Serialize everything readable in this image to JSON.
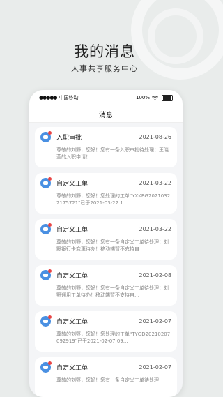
{
  "hero": {
    "title": "我的消息",
    "subtitle": "人事共享服务中心"
  },
  "status_bar": {
    "signal": "●●●●●",
    "carrier": "中国移动",
    "battery_text": "100%"
  },
  "nav": {
    "title": "消息"
  },
  "messages": [
    {
      "title": "入职审批",
      "date": "2021-08-26",
      "body": "尊敬的刘野，您好！您有一条入职审批待处理：王晓莹的入职申请！"
    },
    {
      "title": "自定义工单",
      "date": "2021-03-22",
      "body": "尊敬的刘野，您好！您处理的工单\"YXKBG20210322175721\"已于2021-03-22 1…"
    },
    {
      "title": "自定义工单",
      "date": "2021-03-22",
      "body": "尊敬的刘野，您好！您有一条自定义工单待处理：刘野银行卡变更待办！移动端暂不支持自…"
    },
    {
      "title": "自定义工单",
      "date": "2021-02-08",
      "body": "尊敬的刘野，您好！您有一条自定义工单待处理：刘野通用工单待办！移动端暂不支持自…"
    },
    {
      "title": "自定义工单",
      "date": "2021-02-07",
      "body": "尊敬的刘野，您好！您处理的工单\"TYGD20210207092919\"已于2021-02-07 09…"
    },
    {
      "title": "自定义工单",
      "date": "2021-02-07",
      "body": "尊敬的刘野，您好！您有一条自定义工单待处理"
    }
  ]
}
